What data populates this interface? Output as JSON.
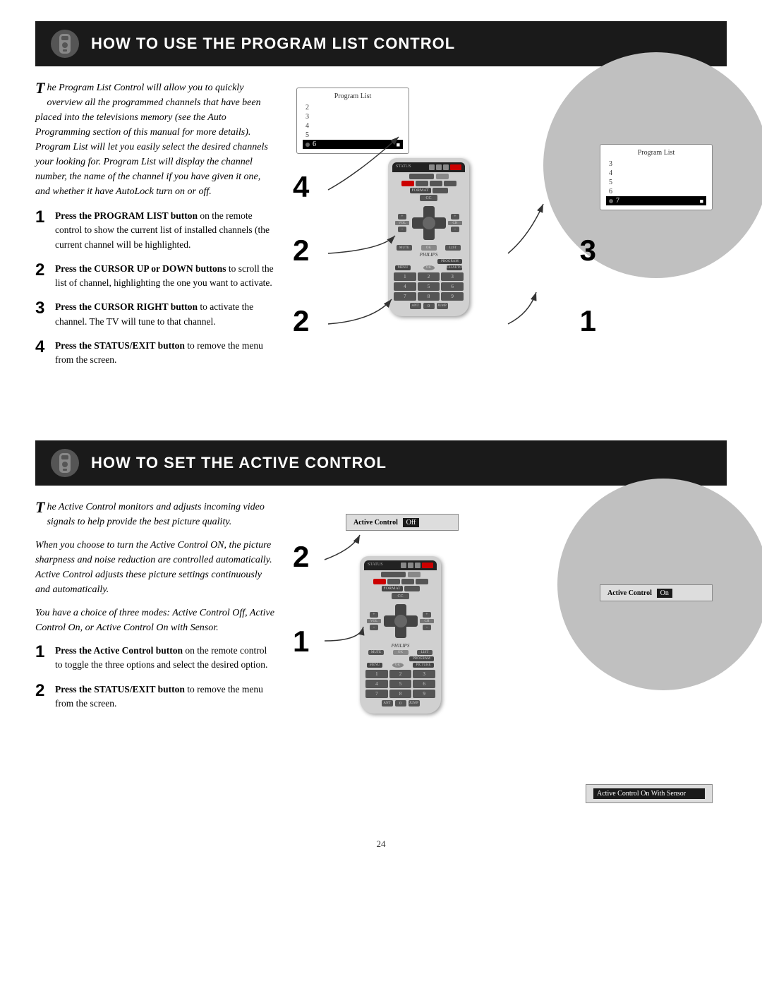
{
  "top_section": {
    "title": "HOW TO USE THE PROGRAM LIST CONTROL",
    "intro": "he Program List Control will allow you to quickly overview all the programmed channels that have been placed into the televisions memory (see the Auto Programming section of this manual for more details). Program List will let you easily select the desired channels your looking for. Program List will display the channel number, the name of the channel if you have given it one, and whether it have AutoLock turn on or off.",
    "steps": [
      {
        "num": "1",
        "text_bold": "Press the PROGRAM LIST button",
        "text": " on the remote control to show the current list of installed channels (the current channel will be highlighted."
      },
      {
        "num": "2",
        "text_bold": "Press the CURSOR UP or DOWN buttons",
        "text": " to scroll the list of channel, highlighting the one you want to activate."
      },
      {
        "num": "3",
        "text_bold": "Press the CURSOR RIGHT button",
        "text": " to activate the channel. The TV will tune to that channel."
      },
      {
        "num": "4",
        "text_bold": "Press the STATUS/EXIT button",
        "text": " to remove the menu from the screen."
      }
    ],
    "tv_screen_left": {
      "title": "Program List",
      "channels": [
        "2",
        "3",
        "4",
        "5",
        "6"
      ],
      "highlighted": "6"
    },
    "tv_screen_right": {
      "title": "Program List",
      "channels": [
        "3",
        "4",
        "5",
        "6",
        "7"
      ],
      "highlighted": "7"
    },
    "callouts": [
      "4",
      "2",
      "3",
      "2",
      "1"
    ]
  },
  "bottom_section": {
    "title": "HOW TO SET THE ACTIVE CONTROL",
    "intro1": "he Active Control monitors and adjusts incoming video signals to help provide the best picture quality.",
    "intro2": "When you choose to turn the Active Control ON, the picture sharpness and noise reduction are controlled automatically. Active Control adjusts these picture settings continuously and automatically.",
    "intro3": "You have a choice of three modes: Active Control Off, Active Control On, or Active Control On with Sensor.",
    "steps": [
      {
        "num": "1",
        "text_bold": "Press the Active Control button",
        "text": " on the remote control to toggle the three options and select the desired option."
      },
      {
        "num": "2",
        "text_bold": "Press the STATUS/EXIT button",
        "text": " to remove the menu from the screen."
      }
    ],
    "screens": [
      {
        "label": "Active Control",
        "value": "Off"
      },
      {
        "label": "Active Control",
        "value": "On"
      },
      {
        "label": "Active Control On With Sensor",
        "value": ""
      }
    ],
    "callouts": [
      "2",
      "1"
    ]
  },
  "page_number": "24"
}
